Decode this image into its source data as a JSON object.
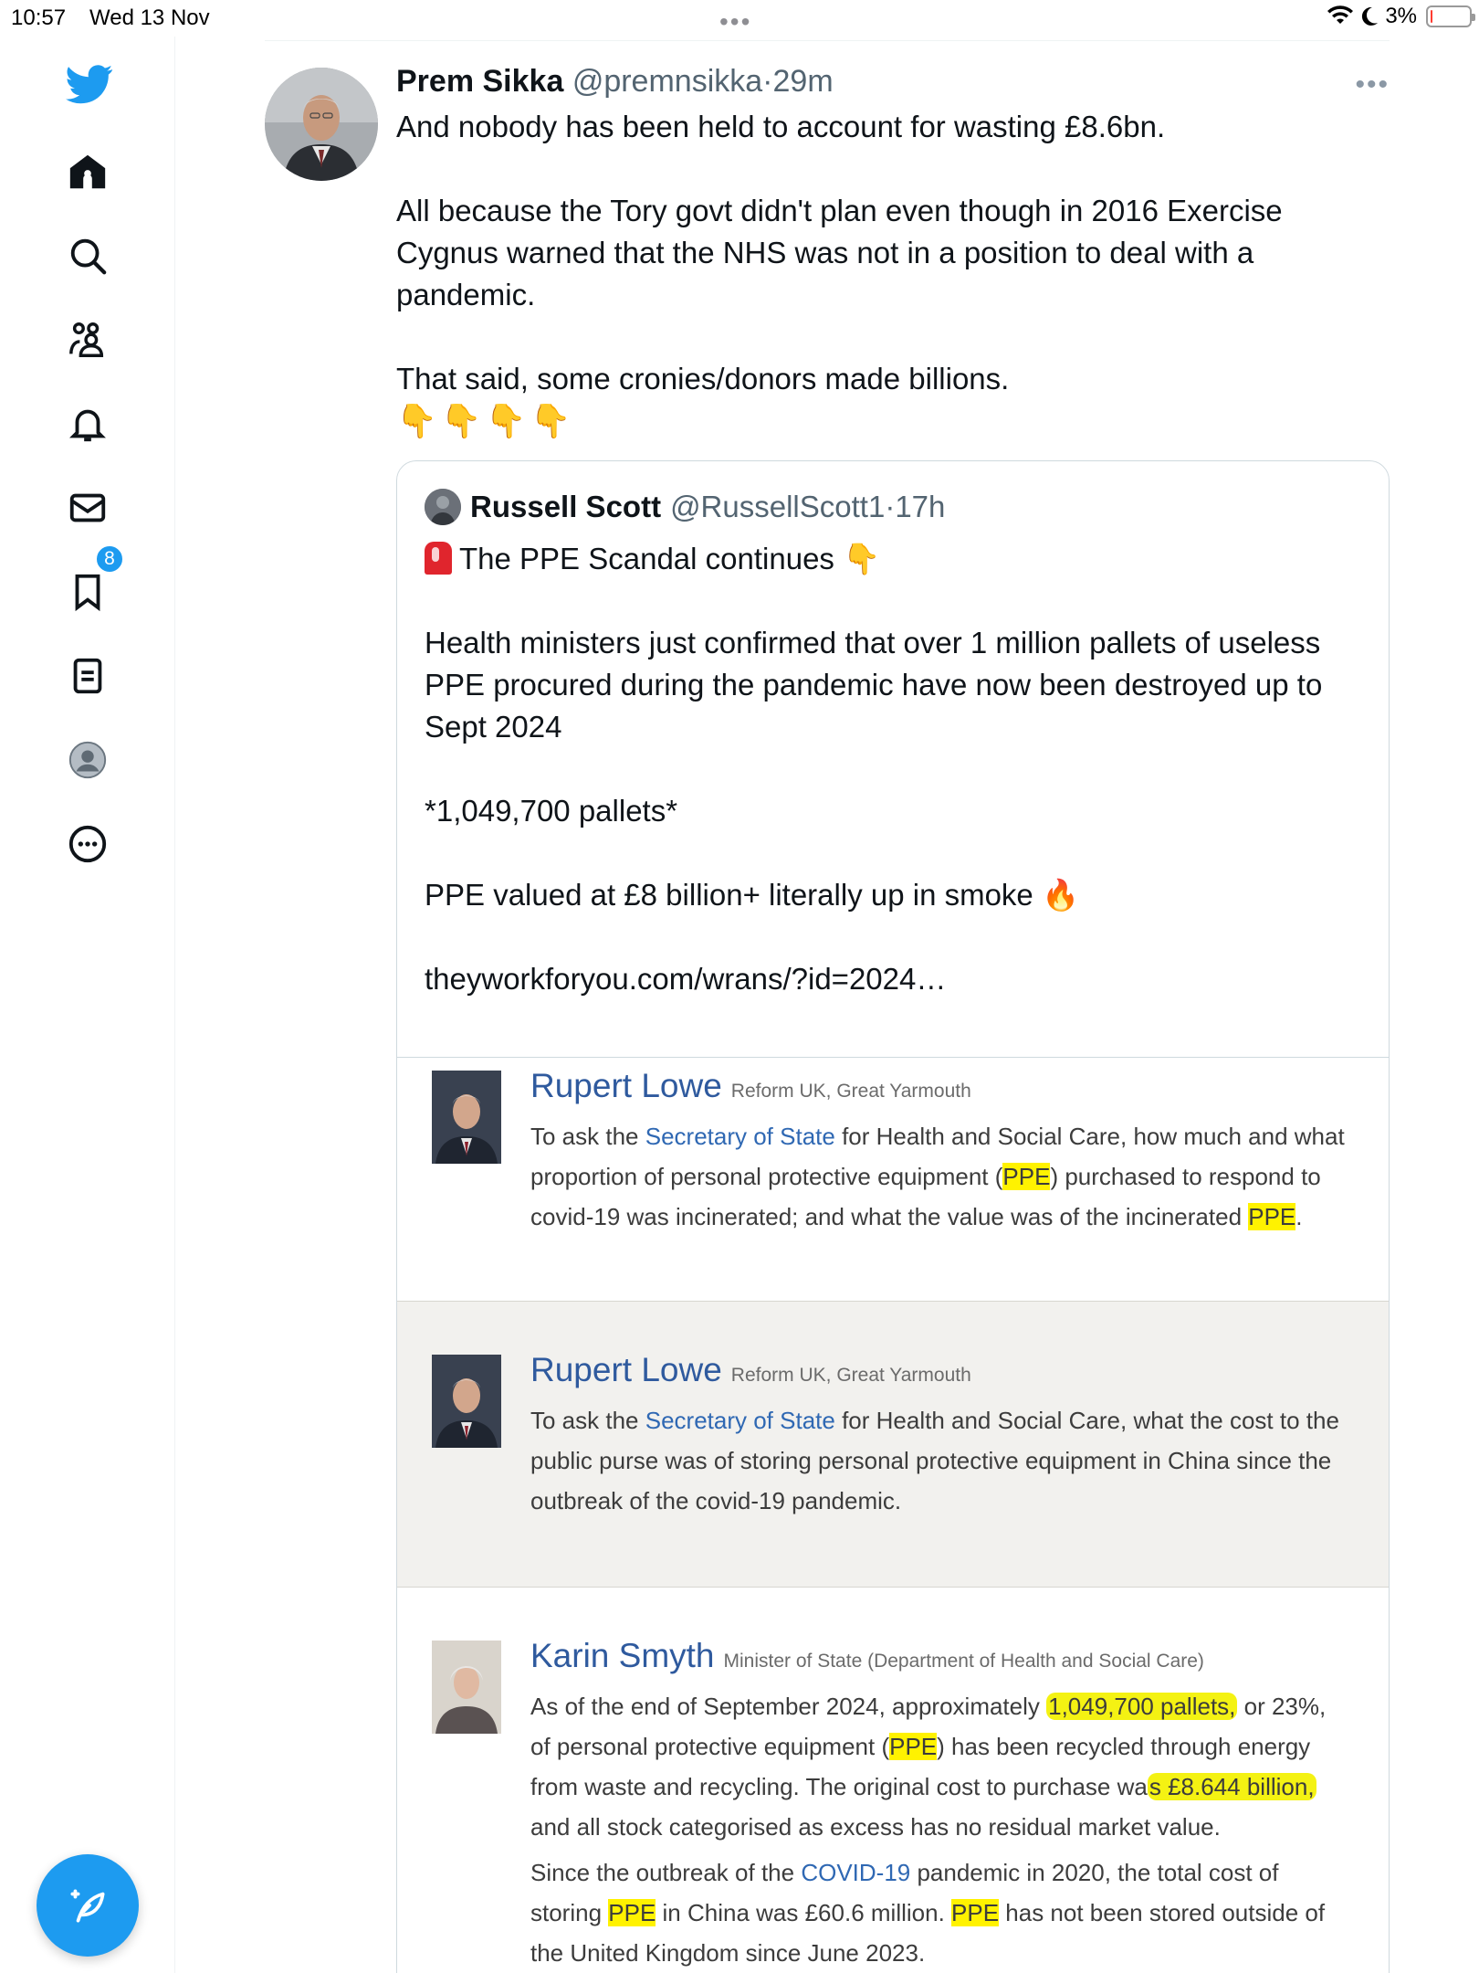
{
  "status_bar": {
    "time": "10:57",
    "date": "Wed 13 Nov",
    "battery": "3%"
  },
  "sidebar": {
    "notifications_badge": "8",
    "items": [
      "home-icon",
      "search-icon",
      "communities-icon",
      "notifications-icon",
      "messages-icon",
      "bookmarks-icon",
      "lists-icon",
      "profile-icon",
      "more-icon"
    ],
    "compose": "compose-icon"
  },
  "tweet": {
    "name": "Prem Sikka",
    "handle": "@premnsikka",
    "sep": "·",
    "time": "29m",
    "more": "•••",
    "lines": [
      "And nobody has been held to account for wasting £8.6bn.",
      "",
      "All because the Tory govt didn't plan even though in 2016 Exercise Cygnus warned that the NHS was not in a position to deal with a pandemic.",
      "",
      "That said, some cronies/donors made billions."
    ],
    "emojis": "👇👇👇👇"
  },
  "quote": {
    "name": "Russell Scott",
    "handle": "@RussellScott1",
    "sep": "·",
    "time": "17h",
    "line1": "The PPE Scandal continues",
    "pointer": "👇",
    "line2": "Health ministers just confirmed that over 1 million pallets of useless PPE procured during the pandemic have now been destroyed up to Sept 2024",
    "line3": " *1,049,700 pallets*",
    "line4": "PPE valued at £8 billion+ literally up in smoke",
    "fire": "🔥",
    "link": "theyworkforyou.com/wrans/?id=2024…"
  },
  "attachment": {
    "q1": {
      "name": "Rupert Lowe",
      "role": "Reform UK, Great Yarmouth",
      "t1": "To ask the ",
      "sos": "Secretary of State",
      "t2": " for Health and Social Care, how much and what proportion of personal protective equipment (",
      "ppe1": "PPE",
      "t3": ") purchased to respond to covid-19 was incinerated; and what the value was of the incinerated ",
      "ppe2": "PPE",
      "t4": "."
    },
    "q2": {
      "name": "Rupert Lowe",
      "role": "Reform UK, Great Yarmouth",
      "t1": "To ask the ",
      "sos": "Secretary of State",
      "t2": " for Health and Social Care, what the cost to the public purse was of storing personal protective equipment in China since the outbreak of the covid-19 pandemic."
    },
    "answer": {
      "name": "Karin Smyth",
      "role": "Minister of State (Department of Health and Social Care)",
      "p1a": "As of the end of September 2024, approximately ",
      "p1hl1": "1,049,700 pallets,",
      "p1b": " or 23%, of personal protective equipment (",
      "p1ppe": "PPE",
      "p1c": ") has been recycled through energy from waste and recycling. The original cost to purchase wa",
      "p1hl2": "s £8.644 billion,",
      "p1d": " and all stock categorised as excess has no residual market value.",
      "p2a": "Since the outbreak of the ",
      "p2link": "COVID-19",
      "p2b": " pandemic in 2020, the total cost of storing ",
      "p2ppe1": "PPE",
      "p2c": " in China was £60.6 million. ",
      "p2ppe2": "PPE",
      "p2d": " has not been stored outside of the United Kingdom since June 2023."
    }
  },
  "colors": {
    "twitter_blue": "#1d9bf0",
    "highlight": "#fff200",
    "hansard_link": "#2f68b3",
    "hansard_name": "#2f5a9e"
  }
}
